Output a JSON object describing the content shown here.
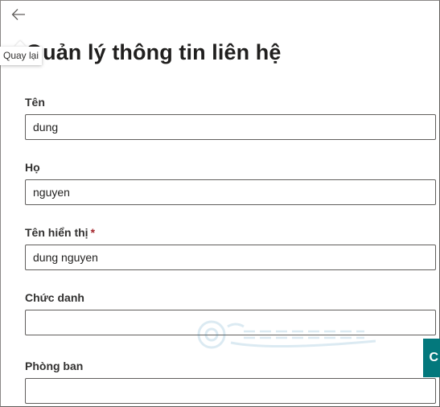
{
  "header": {
    "back_icon": "arrow-left-icon",
    "back_tooltip": "Quay lại",
    "title": "Quản lý thông tin liên hệ"
  },
  "form": {
    "first_name": {
      "label": "Tên",
      "value": "dung"
    },
    "last_name": {
      "label": "Họ",
      "value": "nguyen"
    },
    "display_name": {
      "label": "Tên hiển thị",
      "required_mark": "*",
      "value": "dung nguyen"
    },
    "job_title": {
      "label": "Chức danh",
      "value": ""
    },
    "department": {
      "label": "Phòng ban",
      "value": ""
    }
  },
  "side_tab": {
    "icon": "chat-icon",
    "label": "C"
  },
  "colors": {
    "accent": "#03787c",
    "required": "#a4262c",
    "border": "#605e5c"
  }
}
